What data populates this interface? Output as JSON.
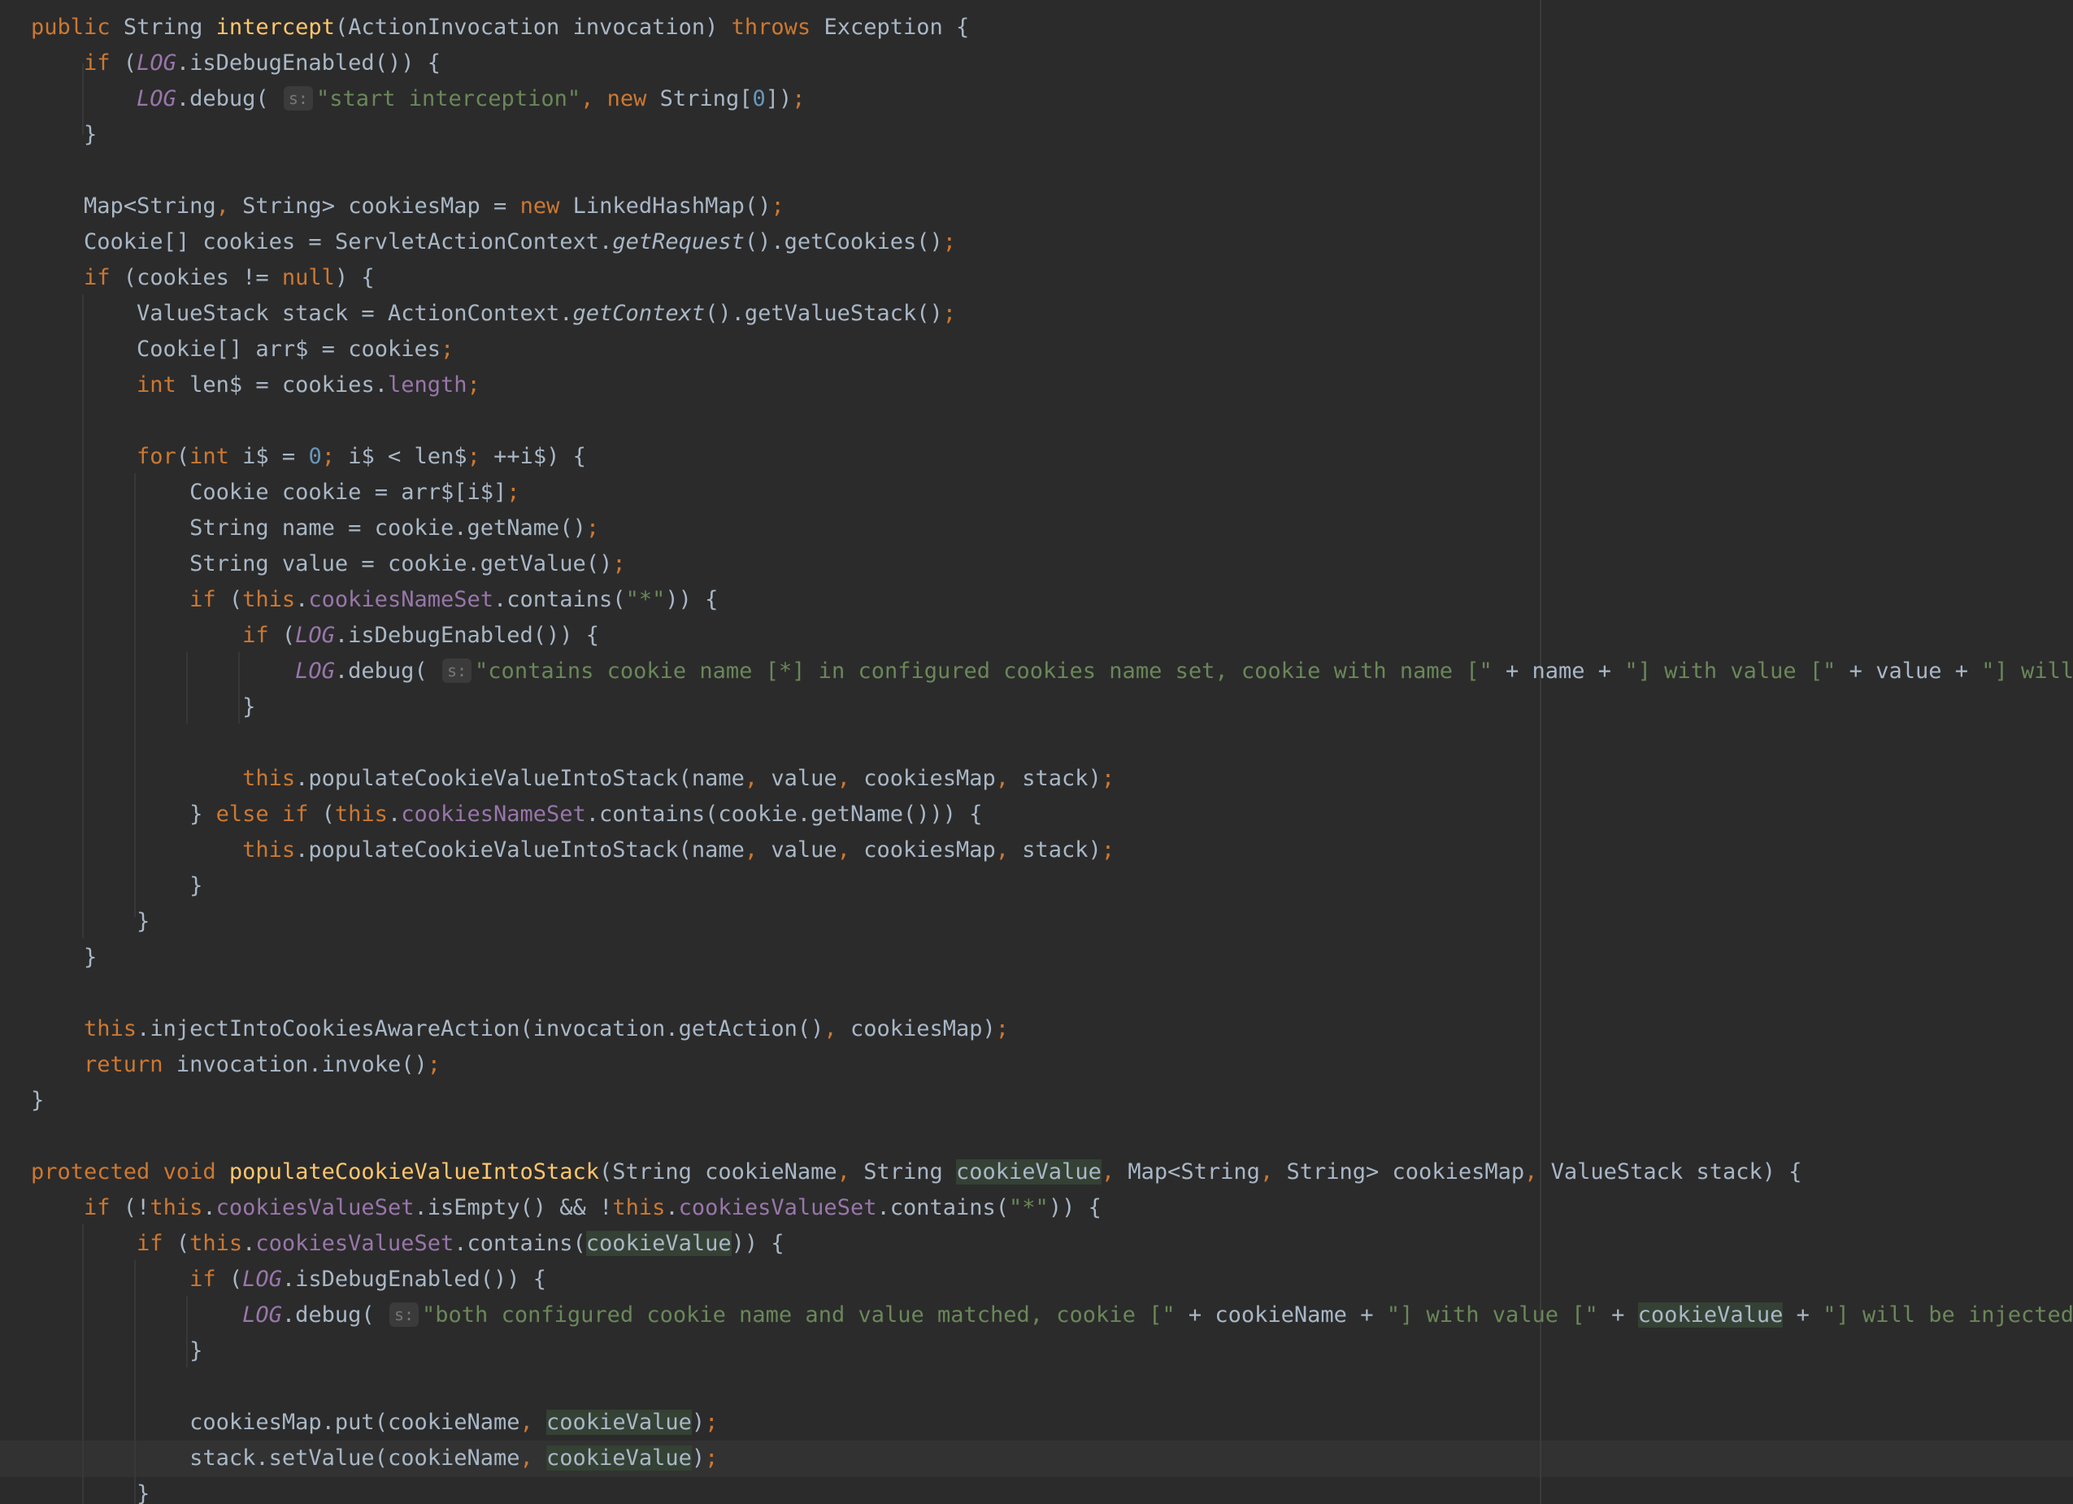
{
  "editor": {
    "hint_label": "s:",
    "lines": [
      "public String intercept(ActionInvocation invocation) throws Exception {",
      "    if (LOG.isDebugEnabled()) {",
      "        LOG.debug( s: \"start interception\", new String[0]);",
      "    }",
      "",
      "    Map<String, String> cookiesMap = new LinkedHashMap();",
      "    Cookie[] cookies = ServletActionContext.getRequest().getCookies();",
      "    if (cookies != null) {",
      "        ValueStack stack = ActionContext.getContext().getValueStack();",
      "        Cookie[] arr$ = cookies;",
      "        int len$ = cookies.length;",
      "",
      "        for(int i$ = 0; i$ < len$; ++i$) {",
      "            Cookie cookie = arr$[i$];",
      "            String name = cookie.getName();",
      "            String value = cookie.getValue();",
      "            if (this.cookiesNameSet.contains(\"*\")) {",
      "                if (LOG.isDebugEnabled()) {",
      "                    LOG.debug( s: \"contains cookie name [*] in configured cookies name set, cookie with name [\" + name + \"] with value [\" + value + \"] will be",
      "                }",
      "",
      "                this.populateCookieValueIntoStack(name, value, cookiesMap, stack);",
      "            } else if (this.cookiesNameSet.contains(cookie.getName())) {",
      "                this.populateCookieValueIntoStack(name, value, cookiesMap, stack);",
      "            }",
      "        }",
      "    }",
      "",
      "    this.injectIntoCookiesAwareAction(invocation.getAction(), cookiesMap);",
      "    return invocation.invoke();",
      "}",
      "",
      "protected void populateCookieValueIntoStack(String cookieName, String cookieValue, Map<String, String> cookiesMap, ValueStack stack) {",
      "    if (!this.cookiesValueSet.isEmpty() && !this.cookiesValueSet.contains(\"*\")) {",
      "        if (this.cookiesValueSet.contains(cookieValue)) {",
      "            if (LOG.isDebugEnabled()) {",
      "                LOG.debug( s: \"both configured cookie name and value matched, cookie [\" + cookieName + \"] with value [\" + cookieValue + \"] will be injected\",",
      "            }",
      "",
      "            cookiesMap.put(cookieName, cookieValue);",
      "            stack.setValue(cookieName, cookieValue);",
      "        }"
    ]
  },
  "syntax": {
    "keywords": [
      "public",
      "protected",
      "void",
      "int",
      "new",
      "null",
      "throws",
      "this",
      "if",
      "else",
      "for",
      "return"
    ],
    "static_fields": [
      "LOG"
    ],
    "fields": [
      "cookiesNameSet",
      "cookiesValueSet",
      "length"
    ],
    "italic_methods": [
      "getRequest",
      "getContext"
    ],
    "highlighted_identifier": "cookieValue",
    "colors": {
      "background": "#2b2b2b",
      "default": "#a9b7c6",
      "keyword": "#cc7832",
      "method_decl": "#ffc66d",
      "string": "#6a8759",
      "number": "#6897bb",
      "field": "#9876aa",
      "hint": "#787878",
      "identifier_highlight": "#344134"
    }
  },
  "caret": {
    "line": 41,
    "column": 38
  }
}
